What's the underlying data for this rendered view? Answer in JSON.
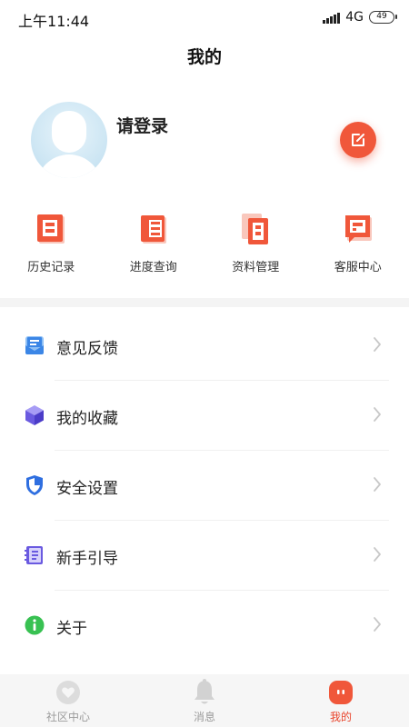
{
  "status_bar": {
    "time": "上午11:44",
    "network": "4G",
    "battery": "49"
  },
  "header": {
    "title": "我的"
  },
  "profile": {
    "login_text": "请登录"
  },
  "quick_actions": [
    {
      "label": "历史记录",
      "icon": "history-record-icon"
    },
    {
      "label": "进度查询",
      "icon": "progress-query-icon"
    },
    {
      "label": "资料管理",
      "icon": "document-manage-icon"
    },
    {
      "label": "客服中心",
      "icon": "customer-service-icon"
    }
  ],
  "menu": [
    {
      "label": "意见反馈",
      "icon": "feedback-mail-icon",
      "color": "#3b86e6"
    },
    {
      "label": "我的收藏",
      "icon": "favorites-cube-icon",
      "color": "#6a5ae0"
    },
    {
      "label": "安全设置",
      "icon": "security-shield-icon",
      "color": "#2f6fe0"
    },
    {
      "label": "新手引导",
      "icon": "guide-book-icon",
      "color": "#6a5ae0"
    },
    {
      "label": "关于",
      "icon": "about-info-icon",
      "color": "#38c152"
    }
  ],
  "tabs": [
    {
      "label": "社区中心",
      "icon": "community-icon",
      "active": false
    },
    {
      "label": "消息",
      "icon": "bell-icon",
      "active": false
    },
    {
      "label": "我的",
      "icon": "profile-icon",
      "active": true
    }
  ],
  "colors": {
    "accent": "#f0573a",
    "active_tab": "#e9452d",
    "inactive_tab": "#9b9b9b"
  }
}
